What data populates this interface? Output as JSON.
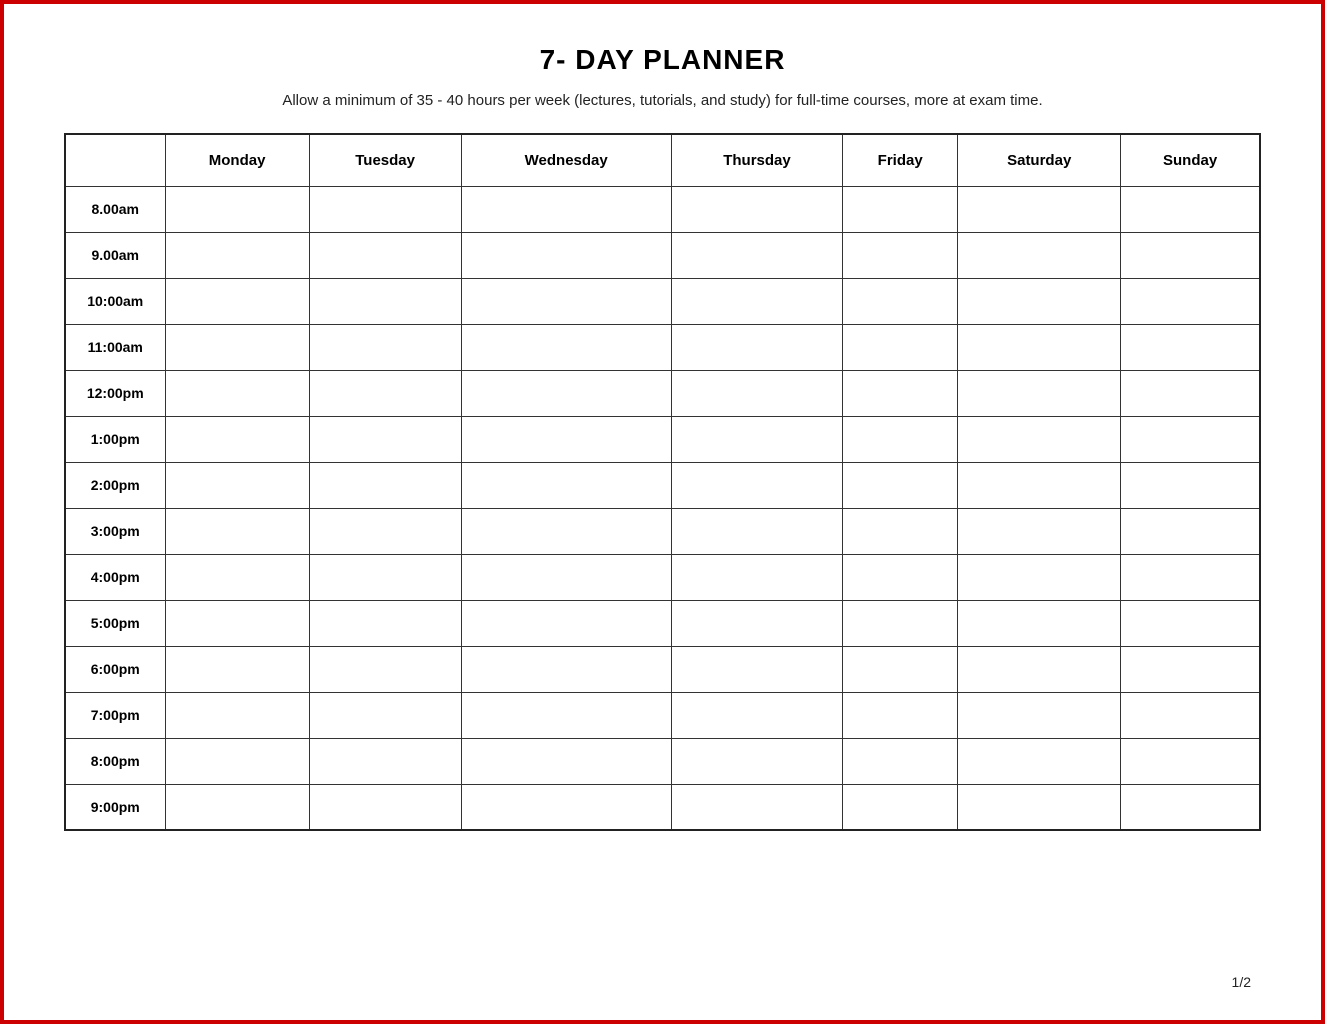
{
  "title": "7- DAY PLANNER",
  "subtitle": "Allow a minimum of 35 - 40 hours per week (lectures, tutorials, and study) for full-time courses, more at exam time.",
  "page_number": "1/2",
  "days": [
    "Monday",
    "Tuesday",
    "Wednesday",
    "Thursday",
    "Friday",
    "Saturday",
    "Sunday"
  ],
  "time_slots": [
    "8.00am",
    "9.00am",
    "10:00am",
    "11:00am",
    "12:00pm",
    "1:00pm",
    "2:00pm",
    "3:00pm",
    "4:00pm",
    "5:00pm",
    "6:00pm",
    "7:00pm",
    "8:00pm",
    "9:00pm"
  ]
}
